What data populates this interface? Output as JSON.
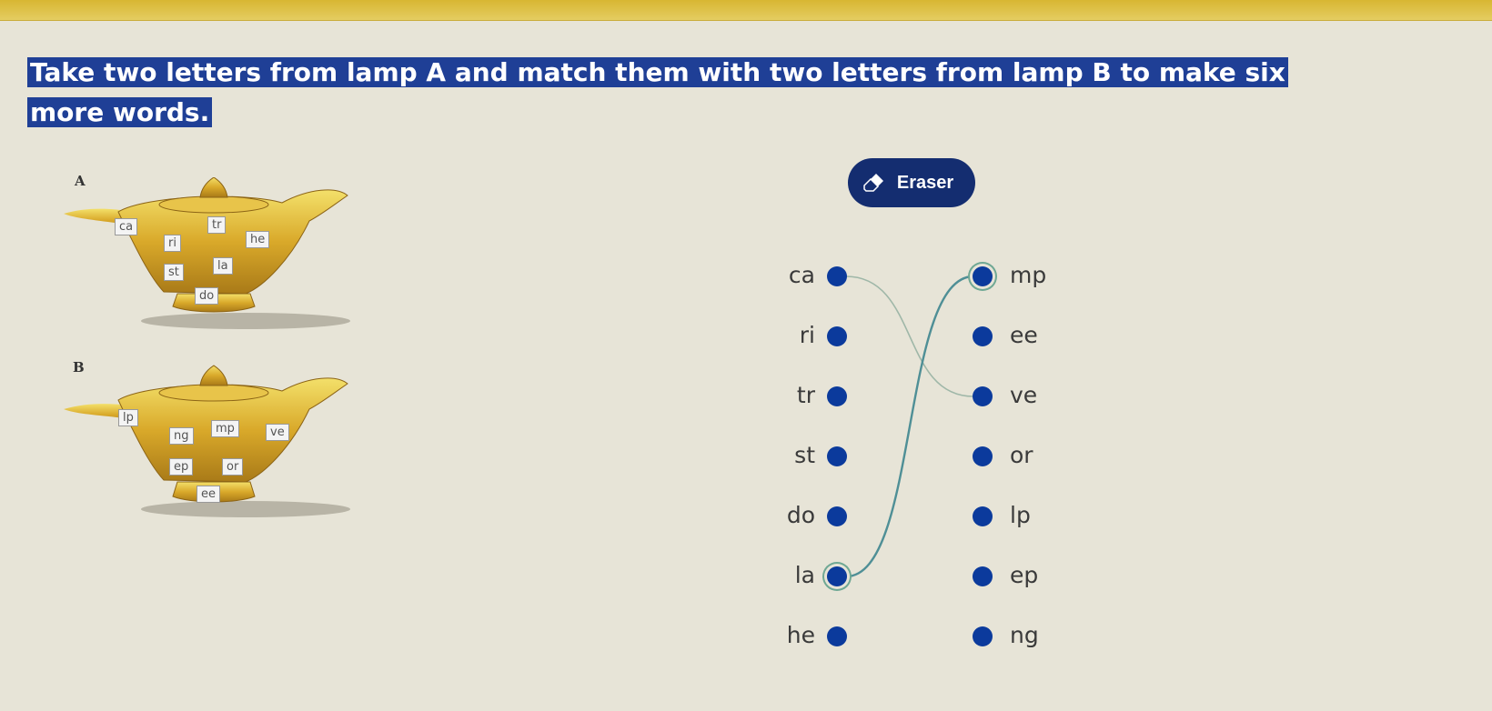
{
  "instructions": "Take two letters from lamp A and match them with two letters from lamp B to make six more words.",
  "lamp_a": {
    "label": "A",
    "tags": [
      "ca",
      "tr",
      "ri",
      "he",
      "st",
      "la",
      "do"
    ]
  },
  "lamp_b": {
    "label": "B",
    "tags": [
      "lp",
      "mp",
      "ng",
      "ve",
      "ep",
      "or",
      "ee"
    ]
  },
  "eraser": {
    "label": "Eraser",
    "icon": "eraser-icon"
  },
  "matching": {
    "left": [
      "ca",
      "ri",
      "tr",
      "st",
      "do",
      "la",
      "he"
    ],
    "right": [
      "mp",
      "ee",
      "ve",
      "or",
      "lp",
      "ep",
      "ng"
    ],
    "connections": [
      {
        "from": "ca",
        "to": "ve"
      },
      {
        "from": "la",
        "to": "mp"
      }
    ]
  },
  "colors": {
    "banner": "#1f3f96",
    "dot": "#0b3a9c",
    "eraser_bg": "#142d70",
    "connector": "#6fa894",
    "top_strip": "#d8b632"
  }
}
